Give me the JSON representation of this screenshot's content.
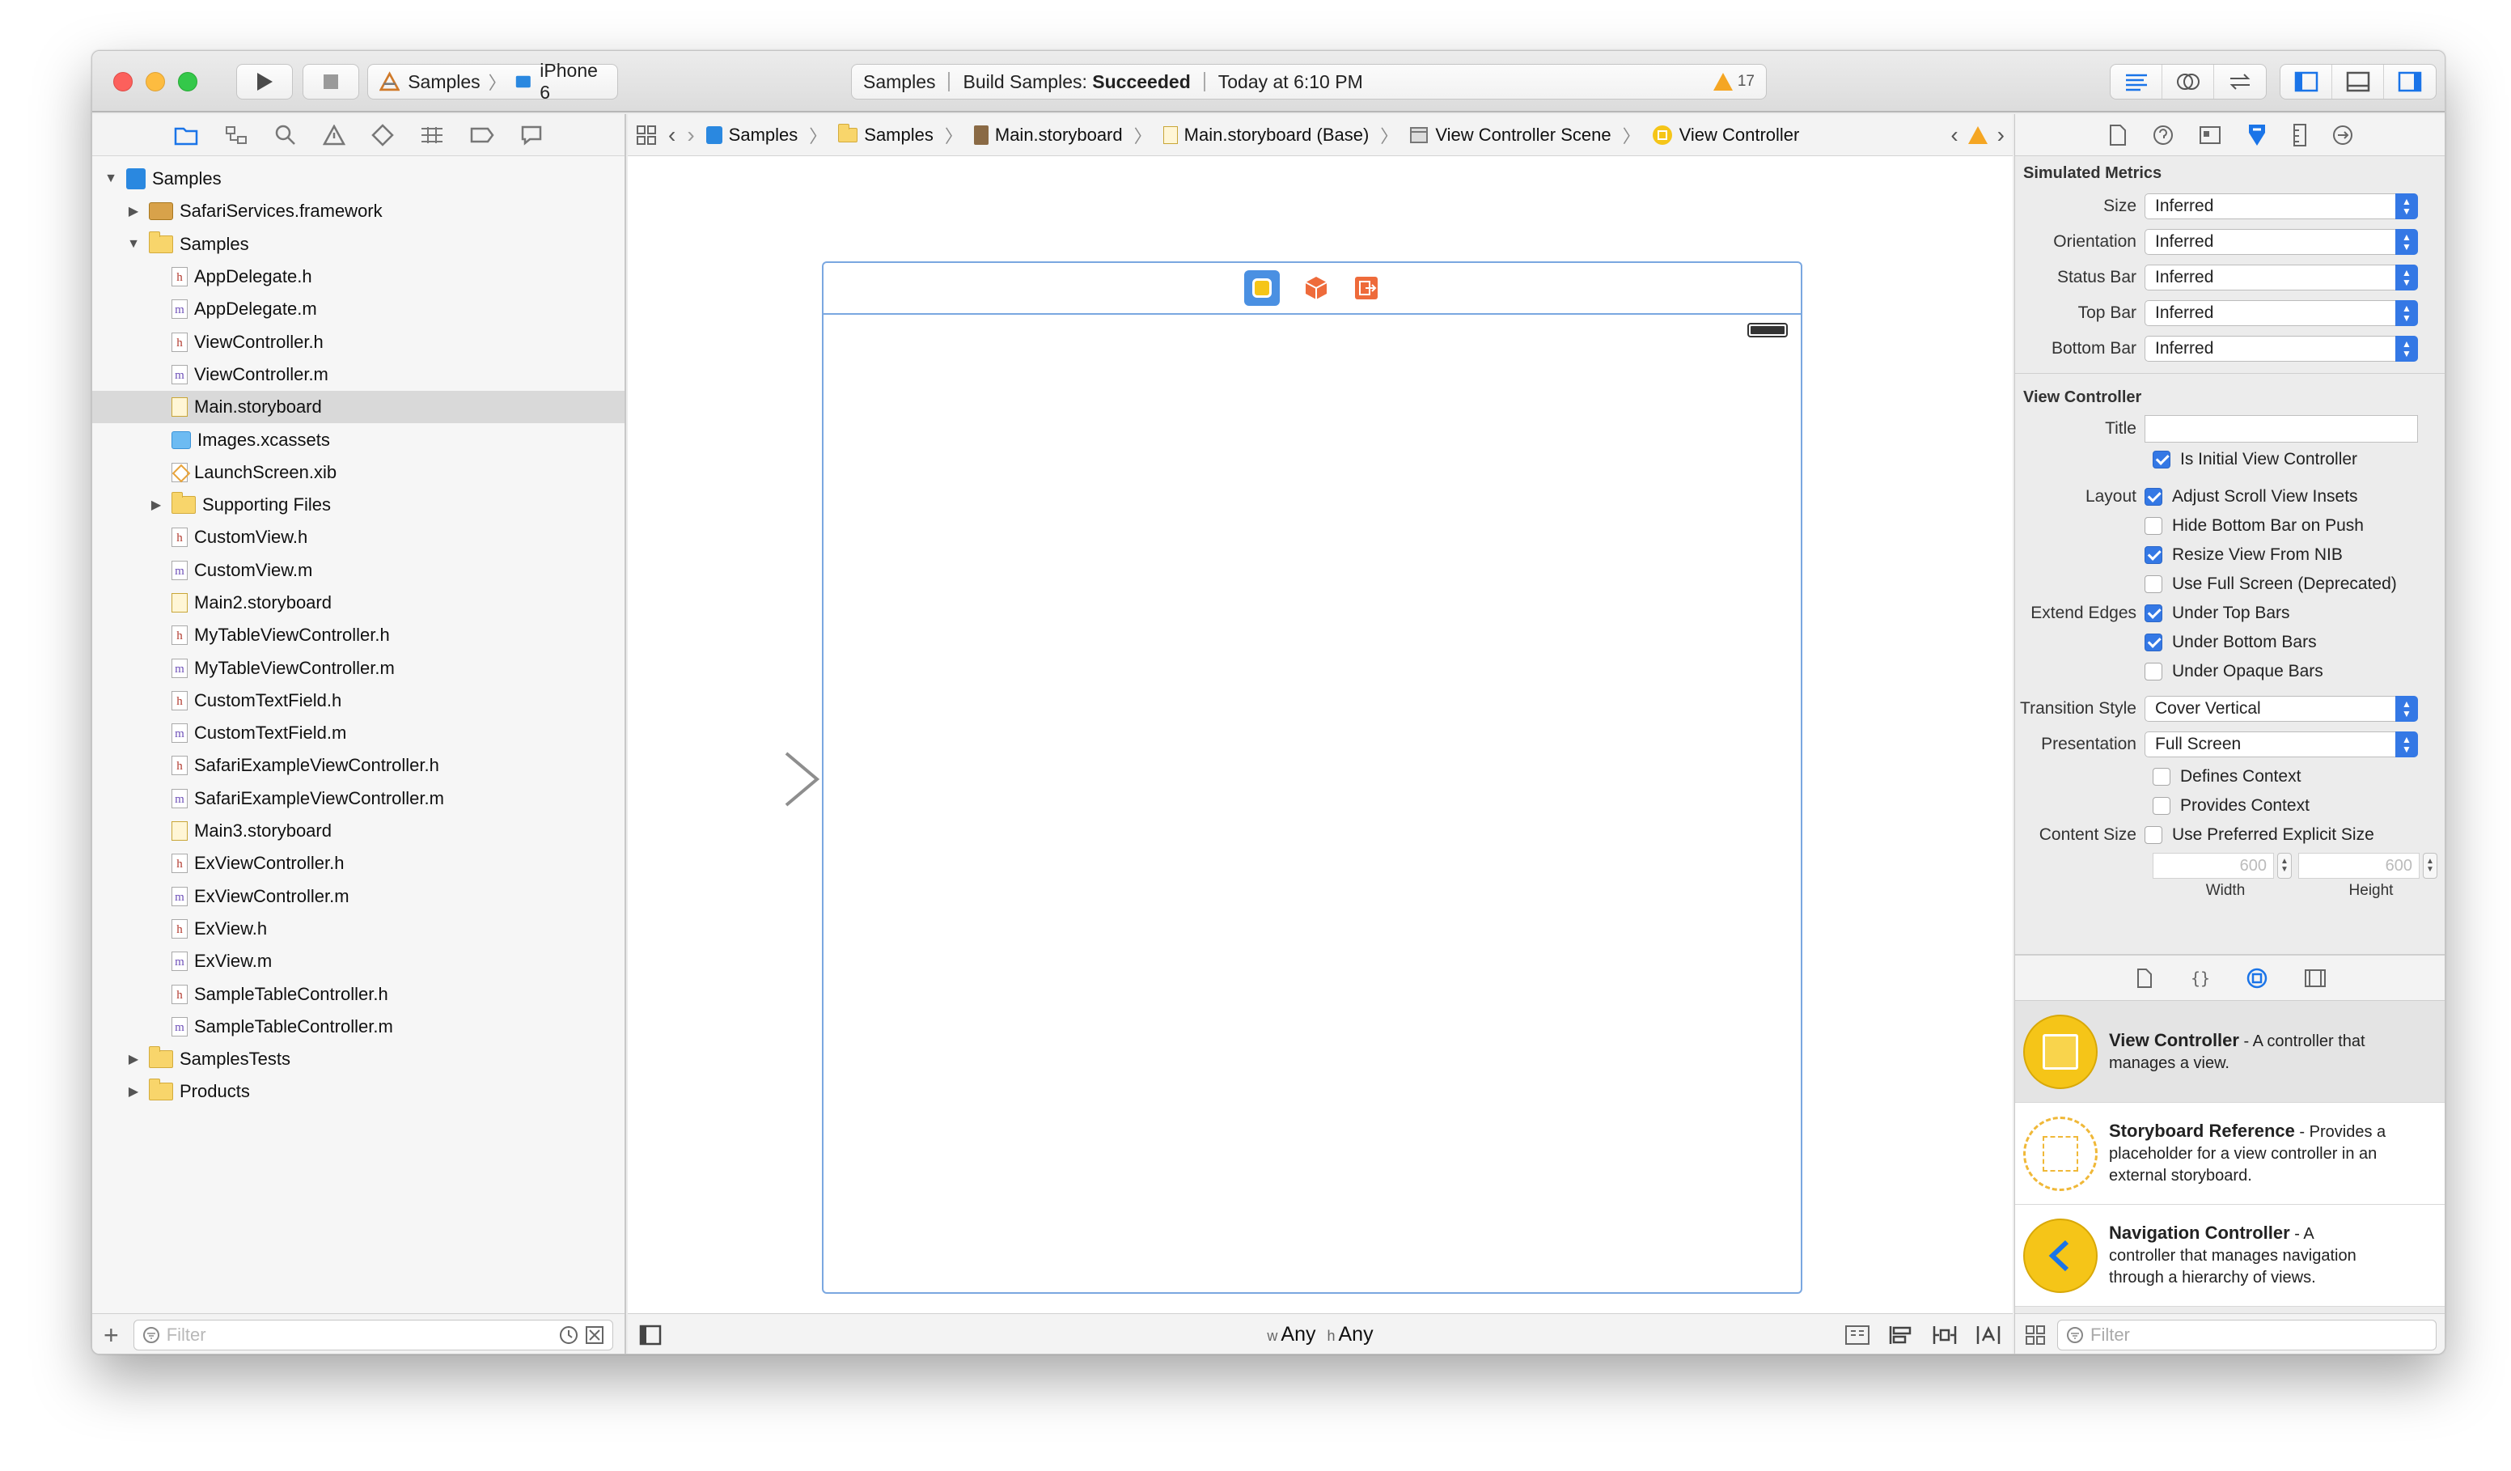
{
  "toolbar": {
    "scheme_target": "Samples",
    "scheme_device": "iPhone 6",
    "activity": {
      "project": "Samples",
      "build_prefix": "Build Samples:",
      "build_status": "Succeeded",
      "time": "Today at 6:10 PM",
      "warning_count": "17"
    }
  },
  "navigator": {
    "filter_placeholder": "Filter",
    "items": [
      {
        "label": "Samples",
        "icon": "project-icon",
        "depth": 0,
        "disclosure": "open"
      },
      {
        "label": "SafariServices.framework",
        "icon": "framework-icon",
        "depth": 1,
        "disclosure": "closed"
      },
      {
        "label": "Samples",
        "icon": "folder-icon",
        "depth": 1,
        "disclosure": "open"
      },
      {
        "label": "AppDelegate.h",
        "icon": "header-file-icon",
        "depth": 2
      },
      {
        "label": "AppDelegate.m",
        "icon": "source-file-icon",
        "depth": 2
      },
      {
        "label": "ViewController.h",
        "icon": "header-file-icon",
        "depth": 2
      },
      {
        "label": "ViewController.m",
        "icon": "source-file-icon",
        "depth": 2
      },
      {
        "label": "Main.storyboard",
        "icon": "storyboard-file-icon",
        "depth": 2,
        "selected": true
      },
      {
        "label": "Images.xcassets",
        "icon": "asset-catalog-icon",
        "depth": 2
      },
      {
        "label": "LaunchScreen.xib",
        "icon": "xib-file-icon",
        "depth": 2
      },
      {
        "label": "Supporting Files",
        "icon": "folder-icon",
        "depth": 2,
        "disclosure": "closed"
      },
      {
        "label": "CustomView.h",
        "icon": "header-file-icon",
        "depth": 2
      },
      {
        "label": "CustomView.m",
        "icon": "source-file-icon",
        "depth": 2
      },
      {
        "label": "Main2.storyboard",
        "icon": "storyboard-file-icon",
        "depth": 2
      },
      {
        "label": "MyTableViewController.h",
        "icon": "header-file-icon",
        "depth": 2
      },
      {
        "label": "MyTableViewController.m",
        "icon": "source-file-icon",
        "depth": 2
      },
      {
        "label": "CustomTextField.h",
        "icon": "header-file-icon",
        "depth": 2
      },
      {
        "label": "CustomTextField.m",
        "icon": "source-file-icon",
        "depth": 2
      },
      {
        "label": "SafariExampleViewController.h",
        "icon": "header-file-icon",
        "depth": 2
      },
      {
        "label": "SafariExampleViewController.m",
        "icon": "source-file-icon",
        "depth": 2
      },
      {
        "label": "Main3.storyboard",
        "icon": "storyboard-file-icon",
        "depth": 2
      },
      {
        "label": "ExViewController.h",
        "icon": "header-file-icon",
        "depth": 2
      },
      {
        "label": "ExViewController.m",
        "icon": "source-file-icon",
        "depth": 2
      },
      {
        "label": "ExView.h",
        "icon": "header-file-icon",
        "depth": 2
      },
      {
        "label": "ExView.m",
        "icon": "source-file-icon",
        "depth": 2
      },
      {
        "label": "SampleTableController.h",
        "icon": "header-file-icon",
        "depth": 2
      },
      {
        "label": "SampleTableController.m",
        "icon": "source-file-icon",
        "depth": 2
      },
      {
        "label": "SamplesTests",
        "icon": "folder-icon",
        "depth": 1,
        "disclosure": "closed"
      },
      {
        "label": "Products",
        "icon": "folder-icon",
        "depth": 1,
        "disclosure": "closed"
      }
    ]
  },
  "jumpbar": {
    "crumbs": [
      "Samples",
      "Samples",
      "Main.storyboard",
      "Main.storyboard (Base)",
      "View Controller Scene",
      "View Controller"
    ]
  },
  "editor": {
    "size_class_w_prefix": "w",
    "size_class_w": "Any",
    "size_class_h_prefix": "h",
    "size_class_h": "Any"
  },
  "inspector": {
    "simulated_metrics": {
      "title": "Simulated Metrics",
      "rows": [
        {
          "label": "Size",
          "value": "Inferred"
        },
        {
          "label": "Orientation",
          "value": "Inferred"
        },
        {
          "label": "Status Bar",
          "value": "Inferred"
        },
        {
          "label": "Top Bar",
          "value": "Inferred"
        },
        {
          "label": "Bottom Bar",
          "value": "Inferred"
        }
      ]
    },
    "view_controller": {
      "title": "View Controller",
      "title_label": "Title",
      "title_value": "",
      "is_initial_label": "Is Initial View Controller",
      "is_initial": true,
      "layout_label": "Layout",
      "layout_options": [
        {
          "label": "Adjust Scroll View Insets",
          "checked": true
        },
        {
          "label": "Hide Bottom Bar on Push",
          "checked": false
        },
        {
          "label": "Resize View From NIB",
          "checked": true
        },
        {
          "label": "Use Full Screen (Deprecated)",
          "checked": false
        }
      ],
      "extend_edges_label": "Extend Edges",
      "extend_edges_options": [
        {
          "label": "Under Top Bars",
          "checked": true
        },
        {
          "label": "Under Bottom Bars",
          "checked": true
        },
        {
          "label": "Under Opaque Bars",
          "checked": false
        }
      ],
      "transition_style_label": "Transition Style",
      "transition_style": "Cover Vertical",
      "presentation_label": "Presentation",
      "presentation": "Full Screen",
      "defines_context_label": "Defines Context",
      "defines_context": false,
      "provides_context_label": "Provides Context",
      "provides_context": false,
      "content_size_label": "Content Size",
      "use_preferred_label": "Use Preferred Explicit Size",
      "use_preferred": false,
      "width_value": "600",
      "height_value": "600",
      "width_label": "Width",
      "height_label": "Height"
    },
    "library": {
      "filter_placeholder": "Filter",
      "items": [
        {
          "name": "View Controller",
          "desc_lines": [
            " - A controller that",
            "manages a view."
          ],
          "icon": "view-controller-icon"
        },
        {
          "name": "Storyboard Reference",
          "desc_lines": [
            " - Provides a",
            "placeholder for a view controller in an",
            "external storyboard."
          ],
          "icon": "storyboard-reference-icon"
        },
        {
          "name": "Navigation Controller",
          "desc_lines": [
            " - A",
            "controller that manages navigation",
            "through a hierarchy of views."
          ],
          "icon": "navigation-controller-icon"
        }
      ]
    }
  },
  "colors": {
    "accent": "#3478e5",
    "scene_border": "#7aa7e0",
    "warning": "#f5a623",
    "vc_yellow": "#f5c518"
  }
}
